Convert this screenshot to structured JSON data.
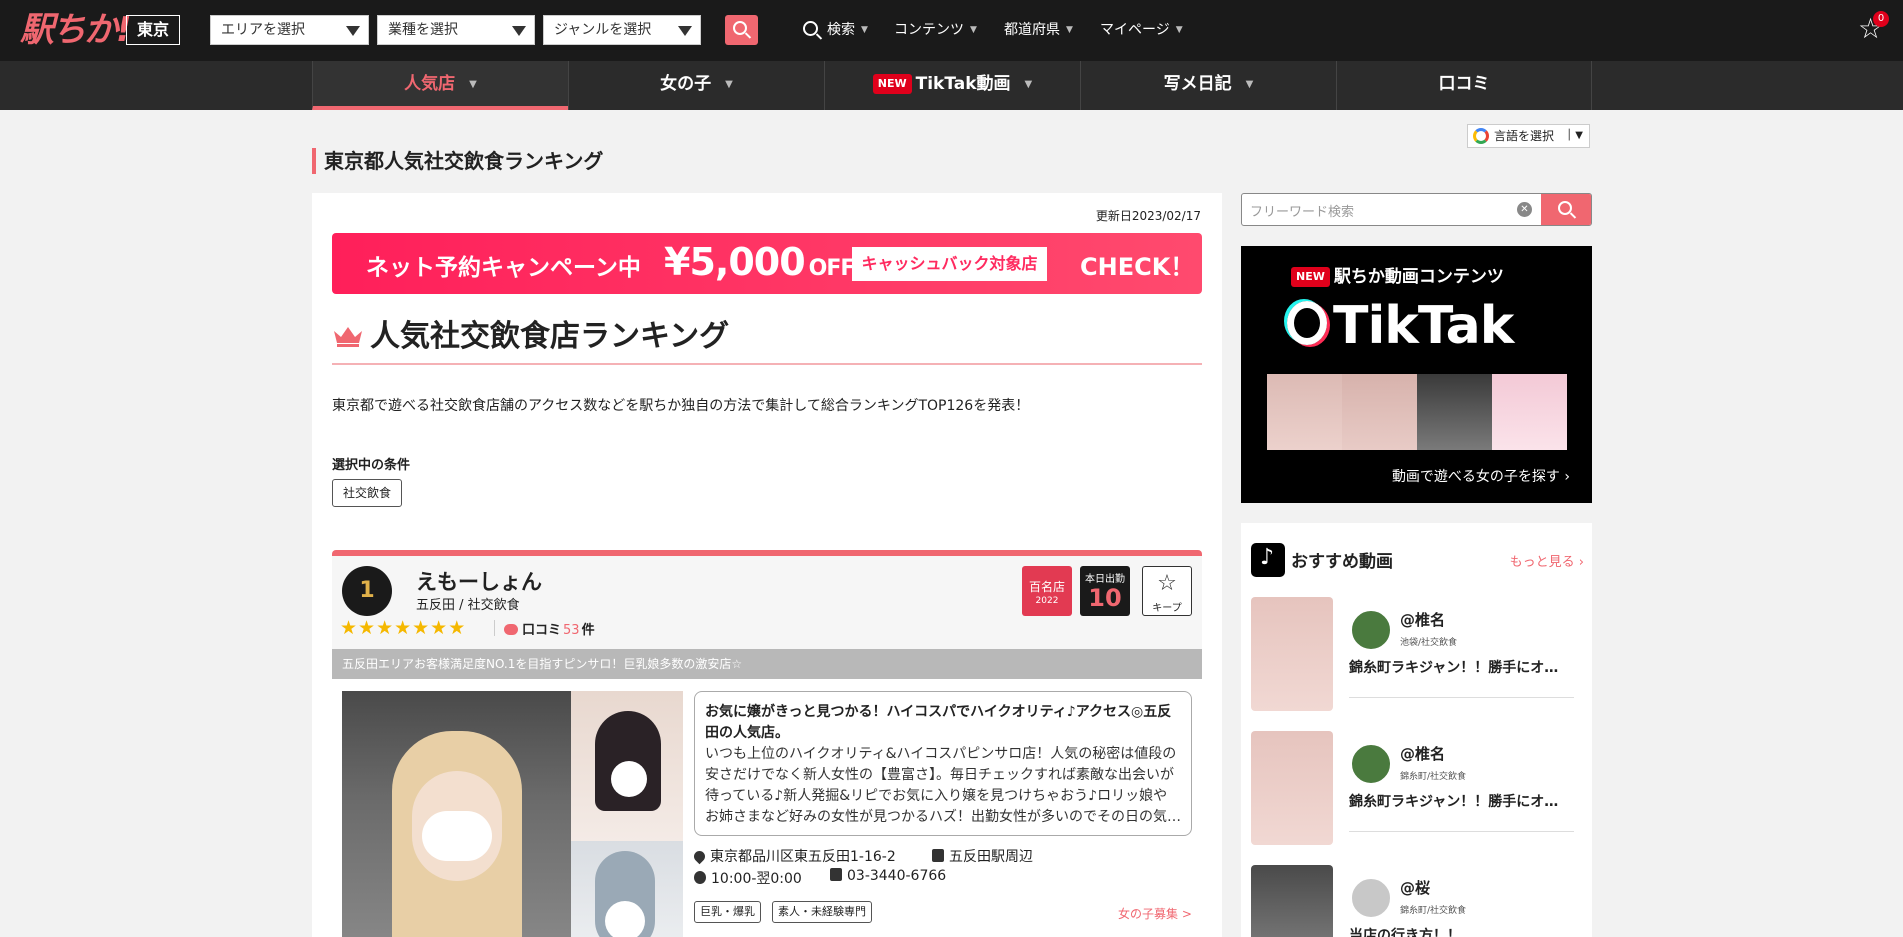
{
  "header": {
    "logo": "駅ちか!",
    "prefecture": "東京",
    "selects": [
      "エリアを選択",
      "業種を選択",
      "ジャンルを選択"
    ],
    "nav": [
      "検索",
      "コンテンツ",
      "都道府県",
      "マイページ"
    ],
    "favorites_count": "0"
  },
  "tabs": [
    {
      "label": "人気店",
      "active": true
    },
    {
      "label": "女の子"
    },
    {
      "label": "TikTak動画",
      "badge": "NEW"
    },
    {
      "label": "写メ日記"
    },
    {
      "label": "口コミ"
    }
  ],
  "language_select": "言語を選択",
  "page_title": "東京都人気社交飲食ランキング",
  "updated": "更新日2023/02/17",
  "campaign": {
    "text": "ネット予約キャンペーン中",
    "amount": "¥5,000",
    "off": "OFF",
    "cashback": "キャッシュバック対象店",
    "check": "CHECK！"
  },
  "ranking_title": "人気社交飲食店ランキング",
  "description": "東京都で遊べる社交飲食店舗のアクセス数などを駅ちか独自の方法で集計して総合ランキングTOP126を発表！",
  "conditions": {
    "label": "選択中の条件",
    "tag": "社交飲食"
  },
  "shop": {
    "rank": "1",
    "name": "えもーしょん",
    "area": "五反田 / 社交飲食",
    "stars": "★★★★★★★",
    "review_label": "口コミ",
    "review_count": "53",
    "review_unit": "件",
    "badge_100": "百名店",
    "badge_100_year": "2022",
    "today_label": "本日出勤",
    "today_count": "10",
    "keep_label": "キープ",
    "catch": "五反田エリアお客様満足度NO.1を目指すピンサロ！巨乳娘多数の激安店☆",
    "pr_heading": "お気に嬢がきっと見つかる！ハイコスパでハイクオリティ♪アクセス◎五反田の人気店。",
    "pr_body": "いつも上位のハイクオリティ&ハイコスパピンサロ店！人気の秘密は値段の安さだけでなく新人女性の【豊富さ】。毎日チェックすれば素敵な出会いが待っている♪新人発掘&リピでお気に入り嬢を見つけちゃおう♪ロリッ娘やお姉さまなど好みの女性が見つかるハズ！出勤女性が多いのでその日の気…",
    "address": "東京都品川区東五反田1-16-2",
    "station": "五反田駅周辺",
    "hours": "10:00-翌0:00",
    "phone": "03-3440-6766",
    "tags": [
      "巨乳・爆乳",
      "素人・未経験専門"
    ],
    "recruit": "女の子募集 >"
  },
  "sidebar": {
    "search_placeholder": "フリーワード検索",
    "tiktak": {
      "badge": "NEW",
      "heading": "駅ちか動画コンテンツ",
      "logo": "TikTak",
      "footer": "動画で遊べる女の子を探す ›"
    },
    "recommended": {
      "title": "おすすめ動画",
      "more": "もっと見る ›",
      "videos": [
        {
          "user": "@椎名",
          "shop": "池袋/社交飲食",
          "title": "錦糸町ラキジャン！！勝手にオ…"
        },
        {
          "user": "@椎名",
          "shop": "錦糸町/社交飲食",
          "title": "錦糸町ラキジャン！！勝手にオ…"
        },
        {
          "user": "@桜",
          "shop": "錦糸町/社交飲食",
          "title": "当店の行き方！！"
        }
      ]
    }
  },
  "colors": {
    "accent": "#f06770",
    "header_bg": "#1a1a1a",
    "campaign": "#ff2a5f"
  }
}
